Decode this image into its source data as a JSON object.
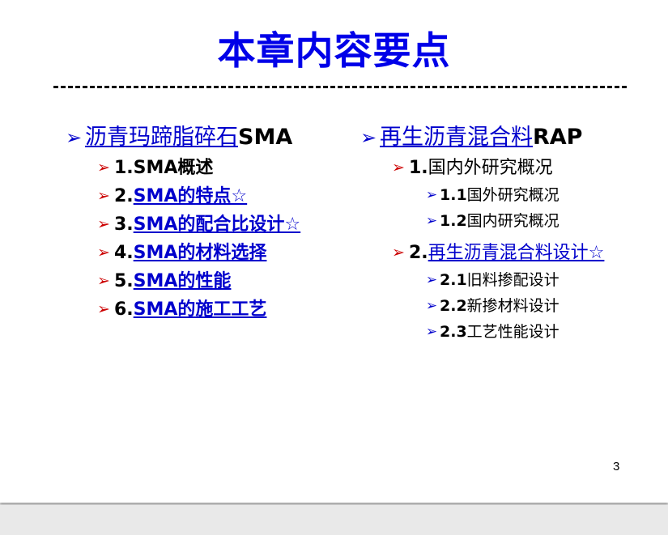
{
  "colors": {
    "title": "#0000e8",
    "link": "#0000cc",
    "text": "#000000",
    "bullet_level1": "#0000cc",
    "bullet_level2": "#cc0000",
    "bullet_level3": "#0000cc"
  },
  "slide": {
    "title": "本章内容要点",
    "page_number": "3"
  },
  "left_column": {
    "heading_link": "沥青玛蹄脂碎石",
    "heading_suffix": "SMA",
    "items": [
      {
        "number": "1.",
        "link": "",
        "text": "SMA概述"
      },
      {
        "number": "2.",
        "link": "SMA的特点☆",
        "text": ""
      },
      {
        "number": "3.",
        "link": "SMA的配合比设计☆",
        "text": ""
      },
      {
        "number": "4.",
        "link": "SMA的材料选择",
        "text": ""
      },
      {
        "number": "5.",
        "link": "SMA的性能",
        "text": ""
      },
      {
        "number": "6.",
        "link": "SMA的施工工艺",
        "text": ""
      }
    ]
  },
  "right_column": {
    "heading_link": "再生沥青混合料",
    "heading_suffix": "RAP",
    "item1": {
      "number": "1.",
      "text": "国内外研究概况"
    },
    "item1_subs": [
      {
        "number": "1.1",
        "text": "国外研究概况"
      },
      {
        "number": "1.2",
        "text": "国内研究概况"
      }
    ],
    "item2": {
      "number": "2.",
      "link": "再生沥青混合料设计☆"
    },
    "item2_subs": [
      {
        "number": "2.1",
        "text": "旧料掺配设计"
      },
      {
        "number": "2.2",
        "text": "新掺材料设计"
      },
      {
        "number": "2.3",
        "text": "工艺性能设计"
      }
    ]
  },
  "icons": {
    "level1_bullet": "arrowhead-outline-icon",
    "level2_bullet": "arrowhead-outline-icon",
    "level3_bullet": "arrowhead-outline-icon",
    "bullet_glyph": "➢"
  }
}
